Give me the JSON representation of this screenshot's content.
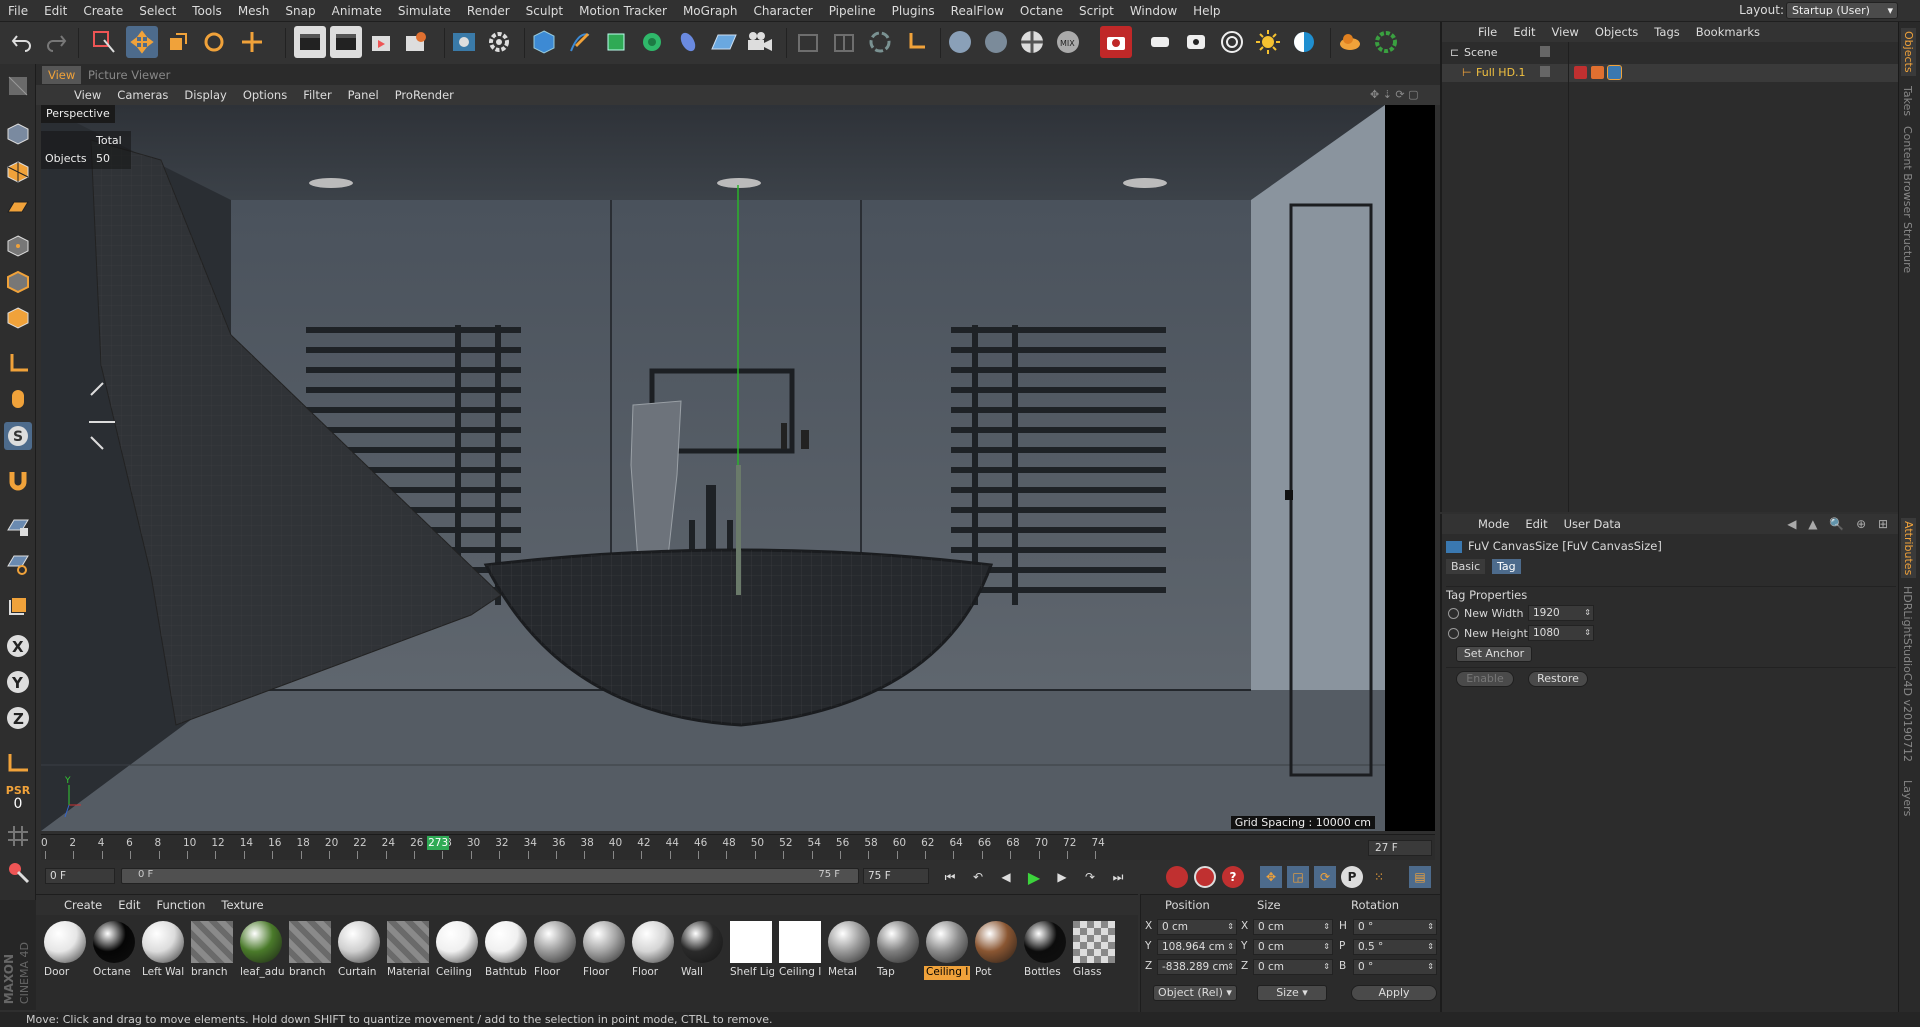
{
  "menubar": {
    "items": [
      "File",
      "Edit",
      "Create",
      "Select",
      "Tools",
      "Mesh",
      "Snap",
      "Animate",
      "Simulate",
      "Render",
      "Sculpt",
      "Motion Tracker",
      "MoGraph",
      "Character",
      "Pipeline",
      "Plugins",
      "RealFlow",
      "Octane",
      "Script",
      "Window",
      "Help"
    ],
    "layout_label": "Layout:",
    "layout_value": "Startup (User)"
  },
  "viewport": {
    "tabs": [
      "View",
      "Picture Viewer"
    ],
    "menu": [
      "View",
      "Cameras",
      "Display",
      "Options",
      "Filter",
      "Panel",
      "ProRender"
    ],
    "camera_label": "Perspective",
    "hud_total": "Total",
    "hud_objects_label": "Objects",
    "hud_objects_value": "50",
    "grid_spacing": "Grid Spacing : 10000 cm"
  },
  "timeline": {
    "ticks": [
      "0",
      "2",
      "4",
      "6",
      "8",
      "10",
      "12",
      "14",
      "16",
      "18",
      "20",
      "22",
      "24",
      "26",
      "28",
      "30",
      "32",
      "34",
      "36",
      "38",
      "40",
      "42",
      "44",
      "46",
      "48",
      "50",
      "52",
      "54",
      "56",
      "58",
      "60",
      "62",
      "64",
      "66",
      "68",
      "70",
      "72",
      "74"
    ],
    "current_marker": "273",
    "end_frame": "27 F"
  },
  "transport": {
    "start_field": "0 F",
    "range_start": "0 F",
    "range_end": "75 F",
    "end_field": "75 F"
  },
  "materials": {
    "menu": [
      "Create",
      "Edit",
      "Function",
      "Texture"
    ],
    "items": [
      {
        "label": "Door",
        "color": "#e6e6e6"
      },
      {
        "label": "Octane",
        "color": "#050505"
      },
      {
        "label": "Left Wal",
        "color": "#dcdcdc"
      },
      {
        "label": "branch",
        "color": "#8a8a8a"
      },
      {
        "label": "leaf_adu",
        "color": "#4a7a2a"
      },
      {
        "label": "branch",
        "color": "#8a8a8a"
      },
      {
        "label": "Curtain",
        "color": "#cfcfcf"
      },
      {
        "label": "Material",
        "color": "#8f8f8f"
      },
      {
        "label": "Ceiling",
        "color": "#f0f0f0"
      },
      {
        "label": "Bathtub",
        "color": "#f0f0f0"
      },
      {
        "label": "Floor",
        "color": "#9a9a9a"
      },
      {
        "label": "Floor",
        "color": "#a5a5a5"
      },
      {
        "label": "Floor",
        "color": "#d5d5d5"
      },
      {
        "label": "Wall",
        "color": "#2a2a2a"
      },
      {
        "label": "Shelf Lig",
        "color": "#ffffff"
      },
      {
        "label": "Ceiling I",
        "color": "#ffffff"
      },
      {
        "label": "Metal",
        "color": "#9a9a9a"
      },
      {
        "label": "Tap",
        "color": "#7f7f7f"
      },
      {
        "label": "Ceiling I",
        "color": "#8c8c8c"
      },
      {
        "label": "Pot",
        "color": "#8a5632"
      },
      {
        "label": "Bottles",
        "color": "#0c0c0c"
      },
      {
        "label": "Glass",
        "color": "#bdbdbd"
      }
    ],
    "selected_index": 18
  },
  "coords": {
    "headers": [
      "Position",
      "Size",
      "Rotation"
    ],
    "rows": [
      {
        "axis": "X",
        "pos": "0 cm",
        "saxis": "X",
        "size": "0 cm",
        "raxis": "H",
        "rot": "0 °"
      },
      {
        "axis": "Y",
        "pos": "108.964 cm",
        "saxis": "Y",
        "size": "0 cm",
        "raxis": "P",
        "rot": "0.5 °"
      },
      {
        "axis": "Z",
        "pos": "-838.289 cm",
        "saxis": "Z",
        "size": "0 cm",
        "raxis": "B",
        "rot": "0 °"
      }
    ],
    "mode_select": "Object (Rel)",
    "size_select": "Size",
    "apply": "Apply"
  },
  "objects": {
    "menu": [
      "File",
      "Edit",
      "View",
      "Objects",
      "Tags",
      "Bookmarks"
    ],
    "tree": [
      {
        "name": "Scene",
        "indent": 0,
        "highlight": false
      },
      {
        "name": "Full HD.1",
        "indent": 1,
        "highlight": true
      }
    ]
  },
  "attributes": {
    "menu": [
      "Mode",
      "Edit",
      "User Data"
    ],
    "title": "FuV CanvasSize [FuV CanvasSize]",
    "tabs": [
      "Basic",
      "Tag"
    ],
    "section": "Tag Properties",
    "width_label": "New Width",
    "width_value": "1920",
    "height_label": "New Height",
    "height_value": "1080",
    "set_anchor": "Set Anchor",
    "enable": "Enable",
    "restore": "Restore"
  },
  "rightstrip": {
    "top_tabs": [
      "Objects",
      "Takes",
      "Content Browser",
      "Structure"
    ],
    "bottom_tabs": [
      "Attributes",
      "HDRLightStudioC4D v20190712",
      "Layers"
    ]
  },
  "left_psr": {
    "label": "PSR",
    "value": "0"
  },
  "brand": {
    "maxon": "MAXON",
    "product": "CINEMA 4D"
  },
  "status": "Move: Click and drag to move elements. Hold down SHIFT to quantize movement / add to the selection in point mode, CTRL to remove.",
  "colors": {
    "accent": "#f0a23a",
    "selected_tab": "#4d6b8c",
    "play": "#3cd33c",
    "record": "#d03030"
  }
}
